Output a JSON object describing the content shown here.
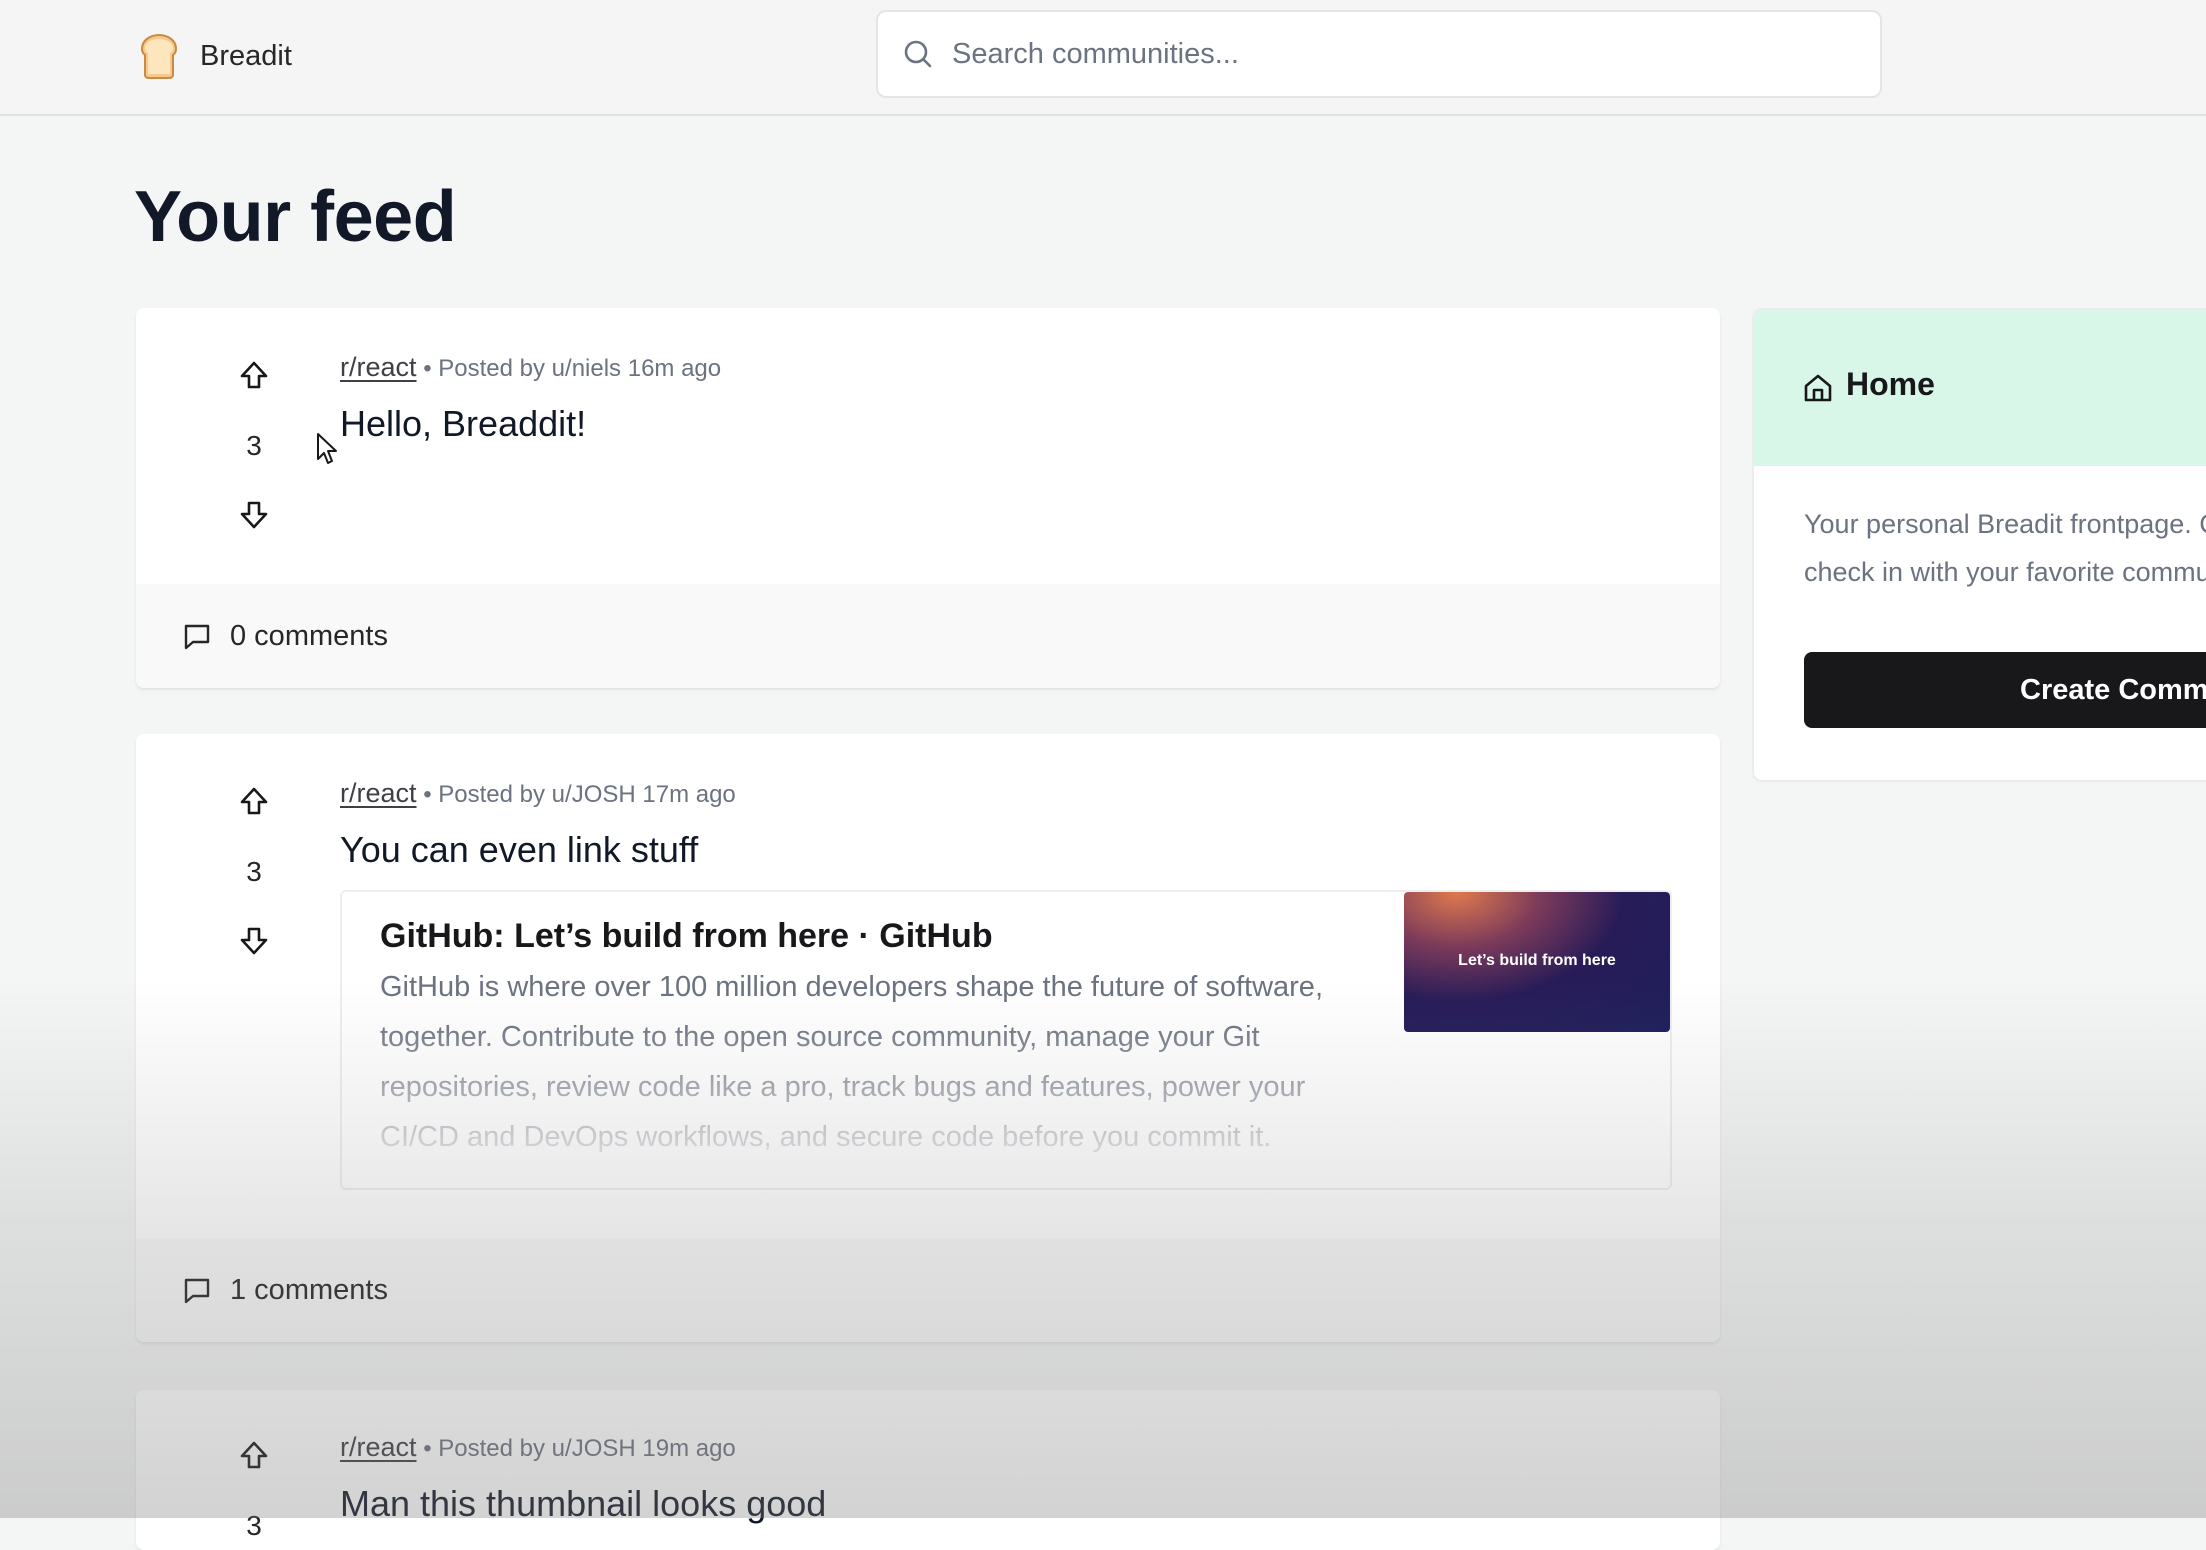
{
  "nav": {
    "brand": "Breadit",
    "search_placeholder": "Search communities..."
  },
  "page_title": "Your feed",
  "posts": [
    {
      "subreddit": "r/react",
      "meta": "• Posted by u/niels 16m ago",
      "title": "Hello, Breaddit!",
      "votes": "3",
      "comments": "0 comments"
    },
    {
      "subreddit": "r/react",
      "meta": "• Posted by u/JOSH 17m ago",
      "title": "You can even link stuff",
      "votes": "3",
      "comments": "1 comments",
      "link_preview": {
        "title": "GitHub: Let’s build from here · GitHub",
        "description": "GitHub is where over 100 million developers shape the future of software, together. Contribute to the open source community, manage your Git repositories, review code like a pro, track bugs and features, power your CI/CD and DevOps workflows, and secure code before you commit it.",
        "thumbnail_text": "Let’s build from here"
      }
    },
    {
      "subreddit": "r/react",
      "meta": "• Posted by u/JOSH 19m ago",
      "title": "Man this thumbnail looks good",
      "votes": "3"
    }
  ],
  "sidebar": {
    "title": "Home",
    "description": "Your personal Breadit frontpage. Come here to check in with your favorite communities.",
    "button_label": "Create Community"
  },
  "colors": {
    "accent_green": "#d9f7e8",
    "button_dark": "#18181b"
  }
}
